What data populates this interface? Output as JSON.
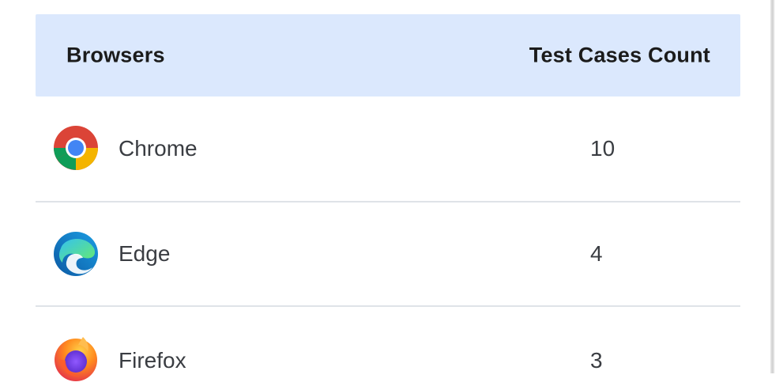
{
  "table": {
    "headers": {
      "browsers": "Browsers",
      "count": "Test Cases Count"
    },
    "rows": [
      {
        "browser": "Chrome",
        "count": "10",
        "icon": "chrome-icon"
      },
      {
        "browser": "Edge",
        "count": "4",
        "icon": "edge-icon"
      },
      {
        "browser": "Firefox",
        "count": "3",
        "icon": "firefox-icon"
      }
    ]
  },
  "colors": {
    "header_bg": "#dbe8fd",
    "divider": "#dfe3e8",
    "text": "#3a3d42"
  }
}
